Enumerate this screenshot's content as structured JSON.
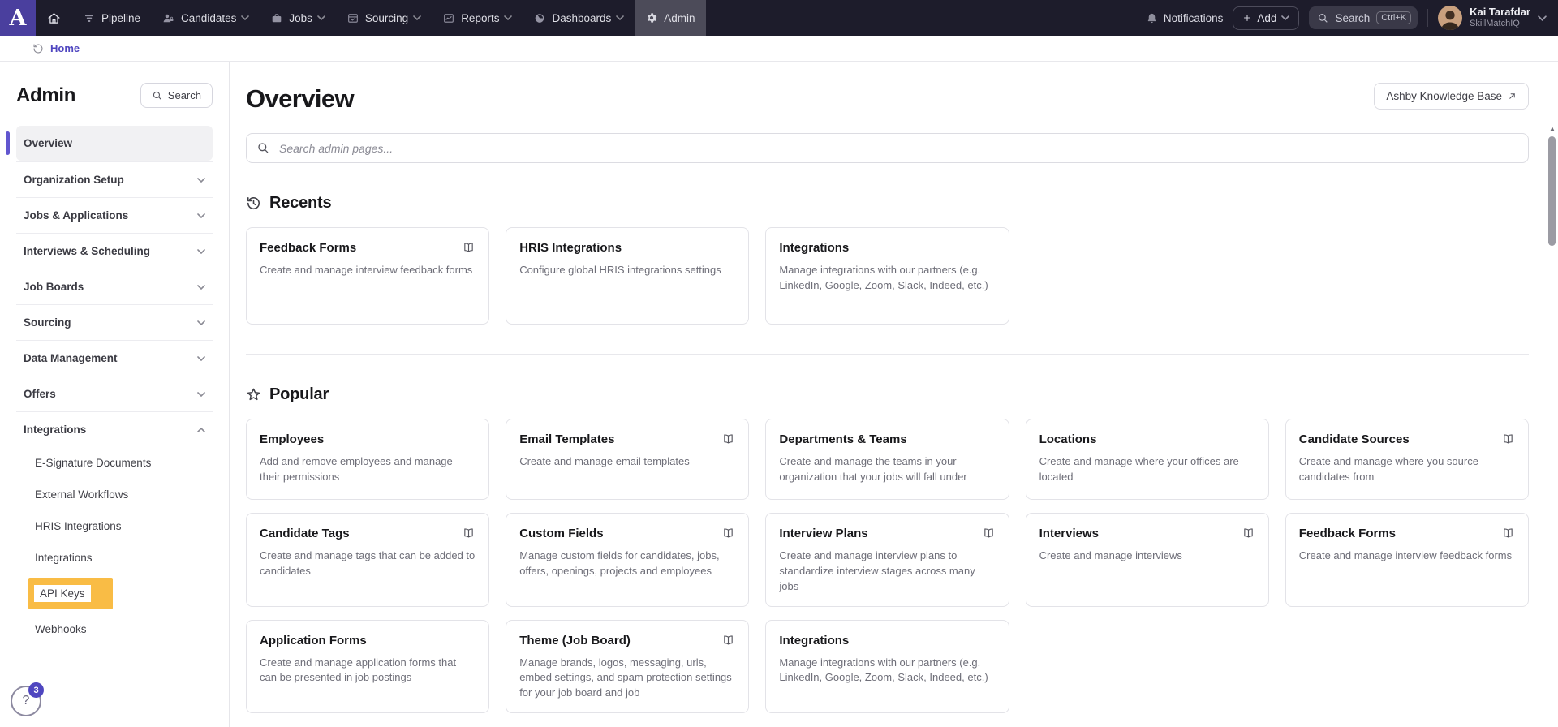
{
  "colors": {
    "topbar_bg": "#1d1c2b",
    "logo_bg": "#4a3f9e",
    "accent": "#4f46c0",
    "active_bar": "#6156cf",
    "highlight": "#f9bc45"
  },
  "topnav": {
    "logo_letter": "A",
    "items": [
      {
        "label": "Pipeline",
        "icon": "pipeline-icon",
        "has_menu": false,
        "active": false
      },
      {
        "label": "Candidates",
        "icon": "candidates-icon",
        "has_menu": true,
        "active": false
      },
      {
        "label": "Jobs",
        "icon": "jobs-icon",
        "has_menu": true,
        "active": false
      },
      {
        "label": "Sourcing",
        "icon": "sourcing-icon",
        "has_menu": true,
        "active": false
      },
      {
        "label": "Reports",
        "icon": "reports-icon",
        "has_menu": true,
        "active": false
      },
      {
        "label": "Dashboards",
        "icon": "dashboards-icon",
        "has_menu": true,
        "active": false
      },
      {
        "label": "Admin",
        "icon": "gear-icon",
        "has_menu": false,
        "active": true
      }
    ],
    "notifications_label": "Notifications",
    "add_label": "Add",
    "search_label": "Search",
    "search_shortcut": "Ctrl+K",
    "user": {
      "name": "Kai Tarafdar",
      "org": "SkillMatchIQ"
    }
  },
  "breadcrumb": {
    "home_label": "Home"
  },
  "sidebar": {
    "title": "Admin",
    "search_label": "Search",
    "items": [
      {
        "label": "Overview",
        "active": true,
        "has_menu": false
      },
      {
        "label": "Organization Setup",
        "has_menu": true
      },
      {
        "label": "Jobs & Applications",
        "has_menu": true
      },
      {
        "label": "Interviews & Scheduling",
        "has_menu": true
      },
      {
        "label": "Job Boards",
        "has_menu": true
      },
      {
        "label": "Sourcing",
        "has_menu": true
      },
      {
        "label": "Data Management",
        "has_menu": true
      },
      {
        "label": "Offers",
        "has_menu": true
      },
      {
        "label": "Integrations",
        "has_menu": true,
        "expanded": true,
        "children": [
          {
            "label": "E-Signature Documents"
          },
          {
            "label": "External Workflows"
          },
          {
            "label": "HRIS Integrations"
          },
          {
            "label": "Integrations"
          },
          {
            "label": "API Keys",
            "highlighted": true
          },
          {
            "label": "Webhooks"
          }
        ]
      }
    ],
    "help_badge": "3"
  },
  "main": {
    "title": "Overview",
    "kb_button_label": "Ashby Knowledge Base",
    "search_placeholder": "Search admin pages...",
    "sections": [
      {
        "title": "Recents",
        "icon": "history-icon",
        "cards": [
          {
            "title": "Feedback Forms",
            "has_doc": true,
            "desc": "Create and manage interview feedback forms"
          },
          {
            "title": "HRIS Integrations",
            "has_doc": false,
            "desc": "Configure global HRIS integrations settings"
          },
          {
            "title": "Integrations",
            "has_doc": false,
            "desc": "Manage integrations with our partners (e.g. LinkedIn, Google, Zoom, Slack, Indeed, etc.)"
          }
        ]
      },
      {
        "title": "Popular",
        "icon": "star-icon",
        "cards": [
          {
            "title": "Employees",
            "has_doc": false,
            "desc": "Add and remove employees and manage their permissions"
          },
          {
            "title": "Email Templates",
            "has_doc": true,
            "desc": "Create and manage email templates"
          },
          {
            "title": "Departments & Teams",
            "has_doc": false,
            "desc": "Create and manage the teams in your organization that your jobs will fall under"
          },
          {
            "title": "Locations",
            "has_doc": false,
            "desc": "Create and manage where your offices are located"
          },
          {
            "title": "Candidate Sources",
            "has_doc": true,
            "desc": "Create and manage where you source candidates from"
          },
          {
            "title": "Candidate Tags",
            "has_doc": true,
            "desc": "Create and manage tags that can be added to candidates"
          },
          {
            "title": "Custom Fields",
            "has_doc": true,
            "desc": "Manage custom fields for candidates, jobs, offers, openings, projects and employees"
          },
          {
            "title": "Interview Plans",
            "has_doc": true,
            "desc": "Create and manage interview plans to standardize interview stages across many jobs"
          },
          {
            "title": "Interviews",
            "has_doc": true,
            "desc": "Create and manage interviews"
          },
          {
            "title": "Feedback Forms",
            "has_doc": true,
            "desc": "Create and manage interview feedback forms"
          },
          {
            "title": "Application Forms",
            "has_doc": false,
            "desc": "Create and manage application forms that can be presented in job postings"
          },
          {
            "title": "Theme (Job Board)",
            "has_doc": true,
            "desc": "Manage brands, logos, messaging, urls, embed settings, and spam protection settings for your job board and job"
          },
          {
            "title": "Integrations",
            "has_doc": false,
            "desc": "Manage integrations with our partners (e.g. LinkedIn, Google, Zoom, Slack, Indeed, etc.)"
          }
        ]
      }
    ]
  }
}
